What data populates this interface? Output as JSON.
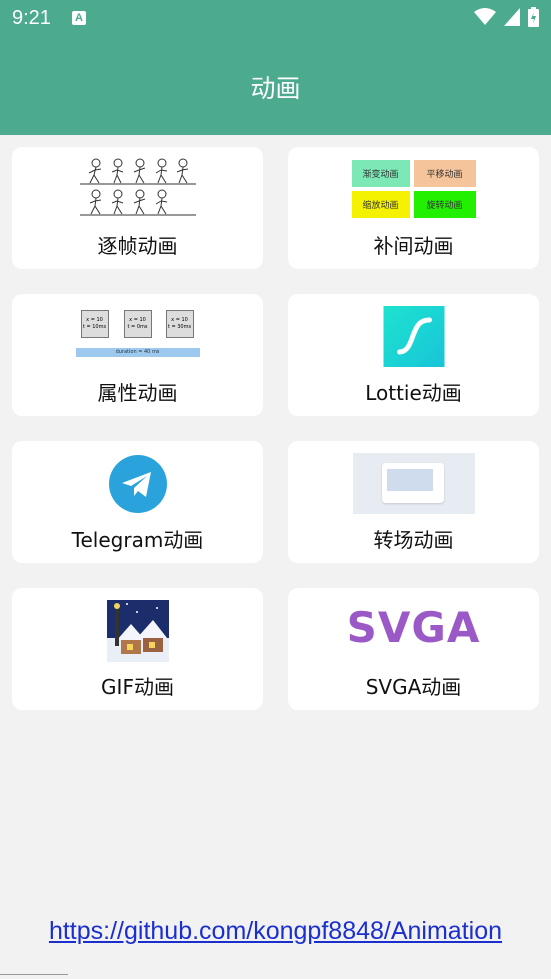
{
  "status_bar": {
    "time": "9:21",
    "notification_icon_letter": "A"
  },
  "app_bar": {
    "title": "动画"
  },
  "cards": [
    {
      "label": "逐帧动画",
      "icon": "frame-animation-sprites"
    },
    {
      "label": "补间动画",
      "icon": "tween-animation-buttons",
      "thumb_tags": [
        "渐变动画",
        "平移动画",
        "缩放动画",
        "旋转动画"
      ]
    },
    {
      "label": "属性动画",
      "icon": "property-animation-boxes",
      "thumb_boxes": [
        "x = 10\nt = 10ms",
        "x = 10\nt = 0ms",
        "x = 10\nt = 30ms"
      ],
      "thumb_bar": "duration = 40 ms"
    },
    {
      "label": "Lottie动画",
      "icon": "lottie-logo"
    },
    {
      "label": "Telegram动画",
      "icon": "telegram-logo"
    },
    {
      "label": "转场动画",
      "icon": "transition-window"
    },
    {
      "label": "GIF动画",
      "icon": "gif-winter-scene"
    },
    {
      "label": "SVGA动画",
      "icon": "svga-logo",
      "thumb_text": "SVGA"
    }
  ],
  "footer": {
    "link": "https://github.com/kongpf8848/Animation"
  },
  "colors": {
    "primary": "#4caa8f",
    "link": "#1b2fcf",
    "svga": "#9b59c8",
    "telegram": "#2aa3dd",
    "lottie": "#1ad2d2"
  }
}
